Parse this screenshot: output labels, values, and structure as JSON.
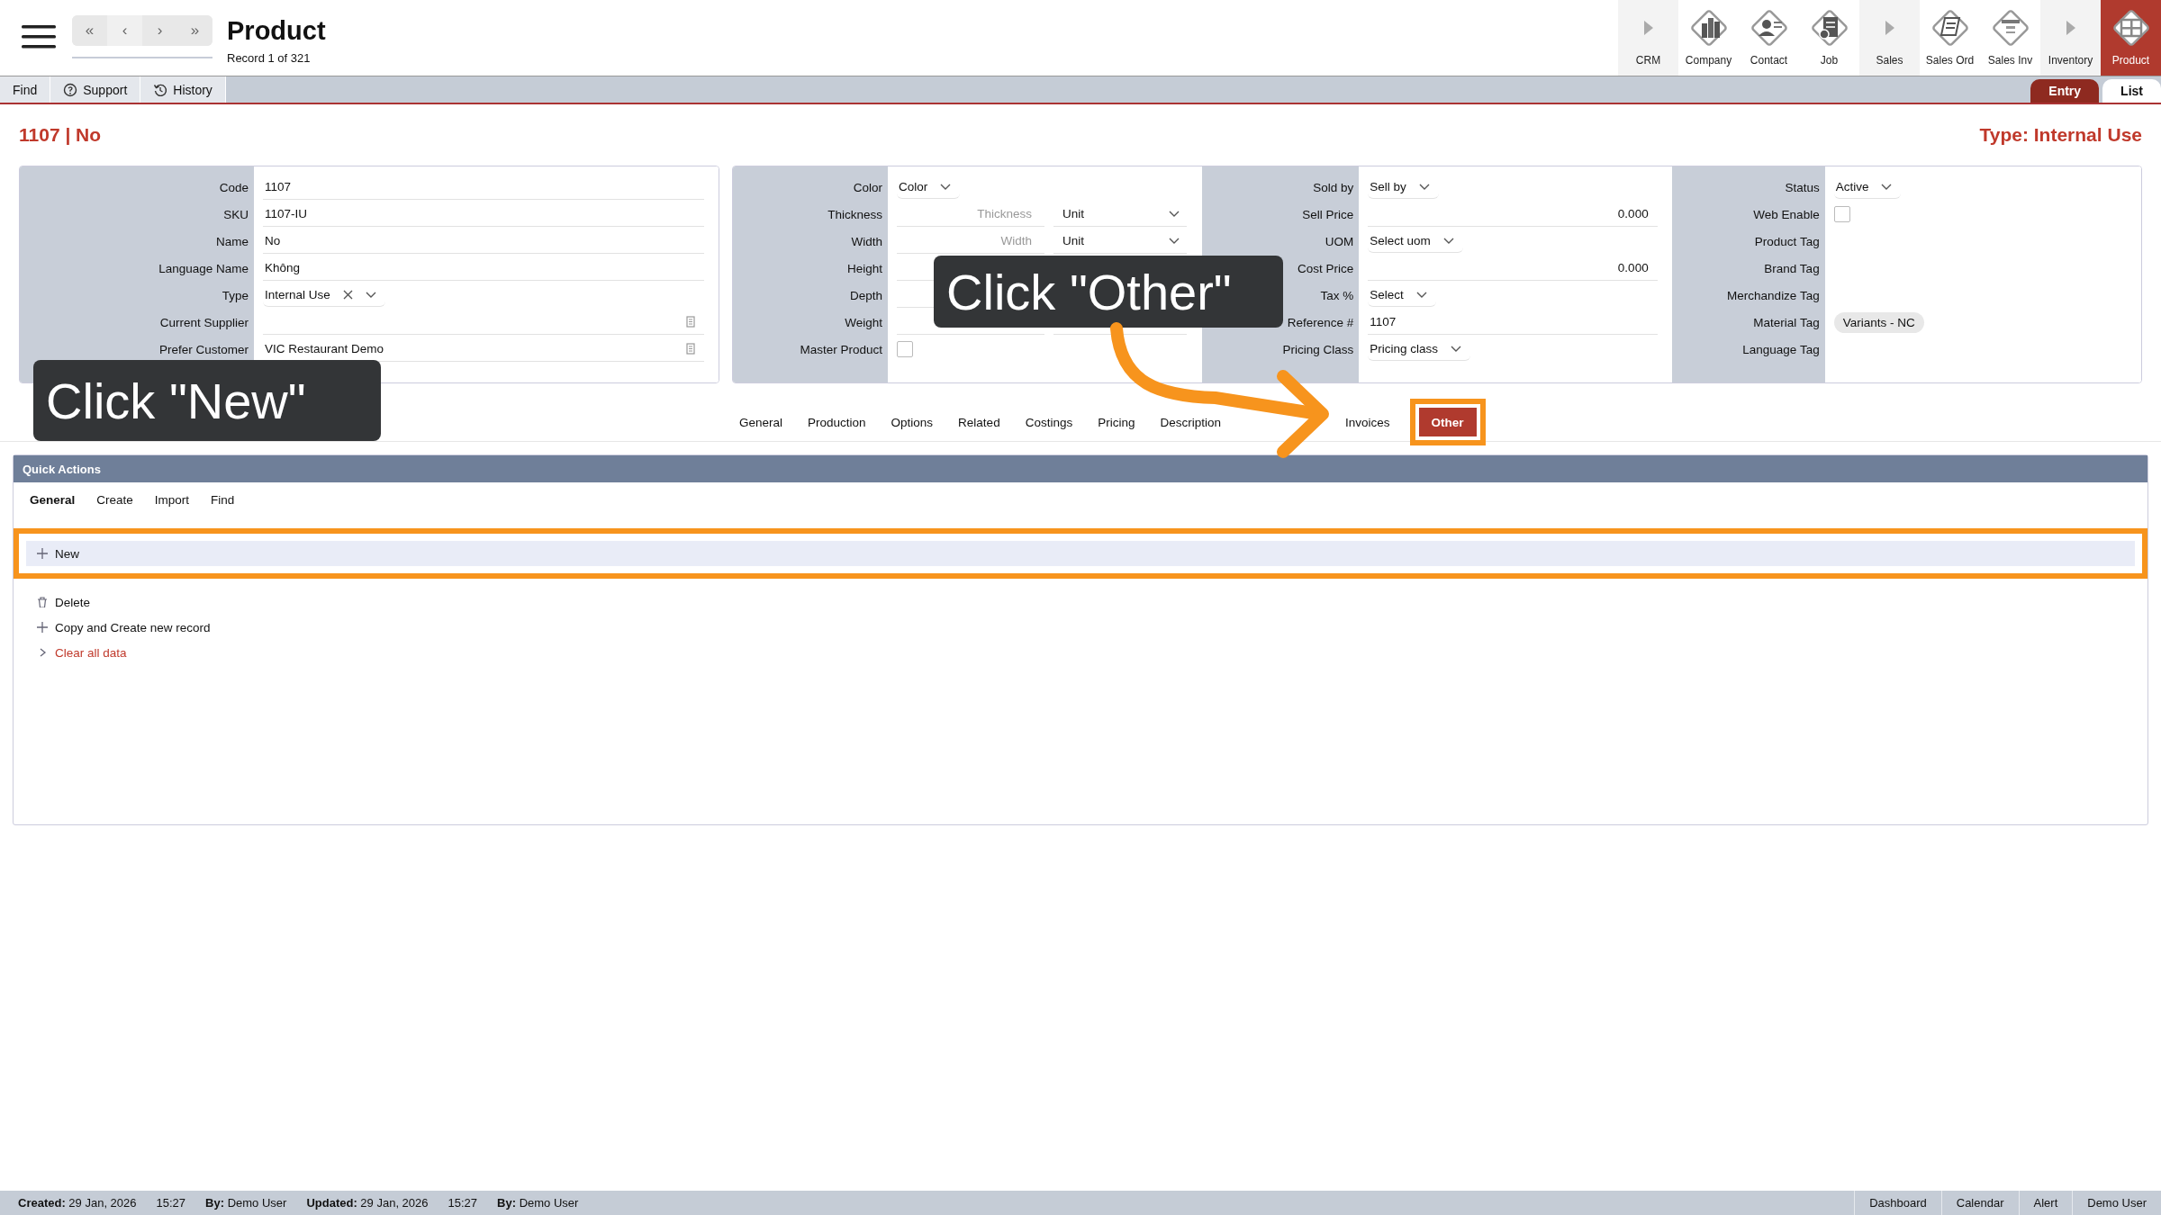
{
  "header": {
    "title": "Product",
    "record": "Record 1 of 321",
    "nav_buttons": [
      "«",
      "‹",
      "›",
      "»"
    ]
  },
  "modules": [
    {
      "label": "CRM",
      "kind": "group",
      "selected": false
    },
    {
      "label": "Company",
      "kind": "module",
      "selected": false
    },
    {
      "label": "Contact",
      "kind": "module",
      "selected": false
    },
    {
      "label": "Job",
      "kind": "module",
      "selected": false
    },
    {
      "label": "Sales",
      "kind": "group",
      "selected": false
    },
    {
      "label": "Sales Ord",
      "kind": "module",
      "selected": false
    },
    {
      "label": "Sales Inv",
      "kind": "module",
      "selected": false
    },
    {
      "label": "Inventory",
      "kind": "group",
      "selected": false
    },
    {
      "label": "Product",
      "kind": "module",
      "selected": true
    }
  ],
  "toolbar": [
    {
      "label": "Find"
    },
    {
      "label": "Support"
    },
    {
      "label": "History"
    }
  ],
  "view_tabs": [
    {
      "label": "Entry",
      "selected": true
    },
    {
      "label": "List",
      "selected": false
    }
  ],
  "record_heading": "1107 | No",
  "type_heading": "Type: Internal Use",
  "form": [
    {
      "fields": [
        {
          "label": "Code",
          "kind": "text",
          "value": "1107"
        },
        {
          "label": "SKU",
          "kind": "text",
          "value": "1107-IU"
        },
        {
          "label": "Name",
          "kind": "text",
          "value": "No"
        },
        {
          "label": "Language Name",
          "kind": "text",
          "value": "Không"
        },
        {
          "label": "Type",
          "kind": "select",
          "value": "Internal Use",
          "clearable": true
        },
        {
          "label": "Current Supplier",
          "kind": "lookup"
        },
        {
          "label": "Prefer Customer",
          "kind": "lookup",
          "value": "VIC Restaurant Demo"
        }
      ]
    },
    {
      "fields": [
        {
          "label": "Color",
          "kind": "select",
          "value": "Color"
        },
        {
          "label": "Thickness",
          "kind": "dimension",
          "placeholder": "Thickness",
          "unit": "Unit"
        },
        {
          "label": "Width",
          "kind": "dimension",
          "placeholder": "Width",
          "unit": "Unit"
        },
        {
          "label": "Height",
          "kind": "dimension"
        },
        {
          "label": "Depth",
          "kind": "dimension"
        },
        {
          "label": "Weight",
          "kind": "dimension"
        },
        {
          "label": "Master Product",
          "kind": "checkbox",
          "checked": false
        }
      ]
    },
    {
      "fields": [
        {
          "label": "Sold by",
          "kind": "select",
          "value": "Sell by"
        },
        {
          "label": "Sell Price",
          "kind": "number",
          "value": "0.000"
        },
        {
          "label": "UOM",
          "kind": "select",
          "value": "Select uom"
        },
        {
          "label": "Cost Price",
          "kind": "number",
          "value": "0.000"
        },
        {
          "label": "Tax %",
          "kind": "select",
          "value": "Select"
        },
        {
          "label": "Reference #",
          "kind": "text",
          "value": "1107"
        },
        {
          "label": "Pricing Class",
          "kind": "select",
          "value": "Pricing class"
        }
      ]
    },
    {
      "fields": [
        {
          "label": "Status",
          "kind": "select",
          "value": "Active"
        },
        {
          "label": "Web Enable",
          "kind": "checkbox",
          "checked": false
        },
        {
          "label": "Product Tag",
          "kind": "tags"
        },
        {
          "label": "Brand Tag",
          "kind": "tags"
        },
        {
          "label": "Merchandize Tag",
          "kind": "tags"
        },
        {
          "label": "Material Tag",
          "kind": "tags",
          "tags": [
            "Variants - NC"
          ]
        },
        {
          "label": "Language Tag",
          "kind": "tags"
        }
      ]
    }
  ],
  "section_tabs": [
    {
      "label": "General",
      "selected": false,
      "highlighted": false
    },
    {
      "label": "Production",
      "selected": false,
      "highlighted": false
    },
    {
      "label": "Options",
      "selected": false,
      "highlighted": false
    },
    {
      "label": "Related",
      "selected": false,
      "highlighted": false
    },
    {
      "label": "Costings",
      "selected": false,
      "highlighted": false
    },
    {
      "label": "Pricing",
      "selected": false,
      "highlighted": false
    },
    {
      "label": "Description",
      "selected": false,
      "highlighted": false
    },
    {
      "label": "Invoices",
      "selected": false,
      "highlighted": false
    },
    {
      "label": "Other",
      "selected": true,
      "highlighted": true
    }
  ],
  "quick_actions": {
    "title": "Quick Actions",
    "tabs": [
      {
        "label": "General",
        "selected": true
      },
      {
        "label": "Create",
        "selected": false
      },
      {
        "label": "Import",
        "selected": false
      },
      {
        "label": "Find",
        "selected": false
      }
    ],
    "actions": [
      {
        "label": "New",
        "kind": "normal",
        "highlighted": true
      },
      {
        "label": "Delete",
        "kind": "normal",
        "highlighted": false
      },
      {
        "label": "Copy and Create new record",
        "kind": "normal",
        "highlighted": false
      },
      {
        "label": "Clear all data",
        "kind": "danger",
        "highlighted": false
      }
    ]
  },
  "footer": {
    "left": [
      "**Created:** 29 Jan, 2026",
      "15:27",
      "**By:** Demo User",
      "**Updated:** 29 Jan, 2026",
      "15:27",
      "**By:** Demo User"
    ],
    "right": [
      "Dashboard",
      "Calendar",
      "Alert",
      "Demo User"
    ]
  },
  "callouts": [
    {
      "text": "Click \"New\""
    },
    {
      "text": "Click \"Other\""
    }
  ]
}
